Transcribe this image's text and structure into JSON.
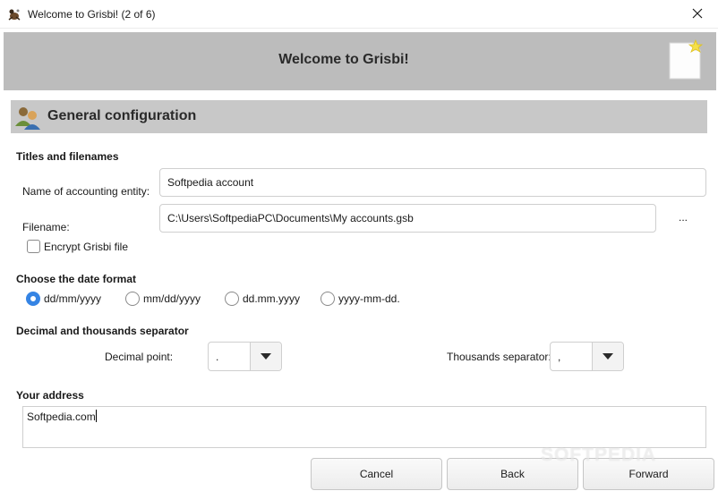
{
  "window": {
    "title": "Welcome to Grisbi! (2 of 6)",
    "app_icon": "grisbi-app-icon",
    "close_icon": "close-icon"
  },
  "banner": {
    "title": "Welcome to Grisbi!",
    "icon": "new-file-icon"
  },
  "section": {
    "title": "General configuration",
    "icon": "users-icon"
  },
  "titles_filenames": {
    "header": "Titles and filenames",
    "entity_label": "Name of accounting entity:",
    "entity_value": "Softpedia account",
    "filename_label": "Filename:",
    "filename_value": "C:\\Users\\SoftpediaPC\\Documents\\My accounts.gsb",
    "browse_label": "...",
    "encrypt_label": "Encrypt Grisbi file",
    "encrypt_checked": false
  },
  "date_format": {
    "header": "Choose the date format",
    "options": [
      "dd/mm/yyyy",
      "mm/dd/yyyy",
      "dd.mm.yyyy",
      "yyyy-mm-dd."
    ],
    "selected": "dd/mm/yyyy"
  },
  "separators": {
    "header": "Decimal and thousands separator",
    "decimal_label": "Decimal point:",
    "decimal_value": ".",
    "thousands_label": "Thousands separator:",
    "thousands_value": ","
  },
  "address": {
    "header": "Your address",
    "value": "Softpedia.com"
  },
  "buttons": {
    "cancel": "Cancel",
    "back": "Back",
    "forward": "Forward"
  },
  "watermark": "SOFTPEDIA",
  "colors": {
    "accent": "#3584e4",
    "banner_bg": "#bcbcbc",
    "section_bg": "#c8c8c8"
  }
}
